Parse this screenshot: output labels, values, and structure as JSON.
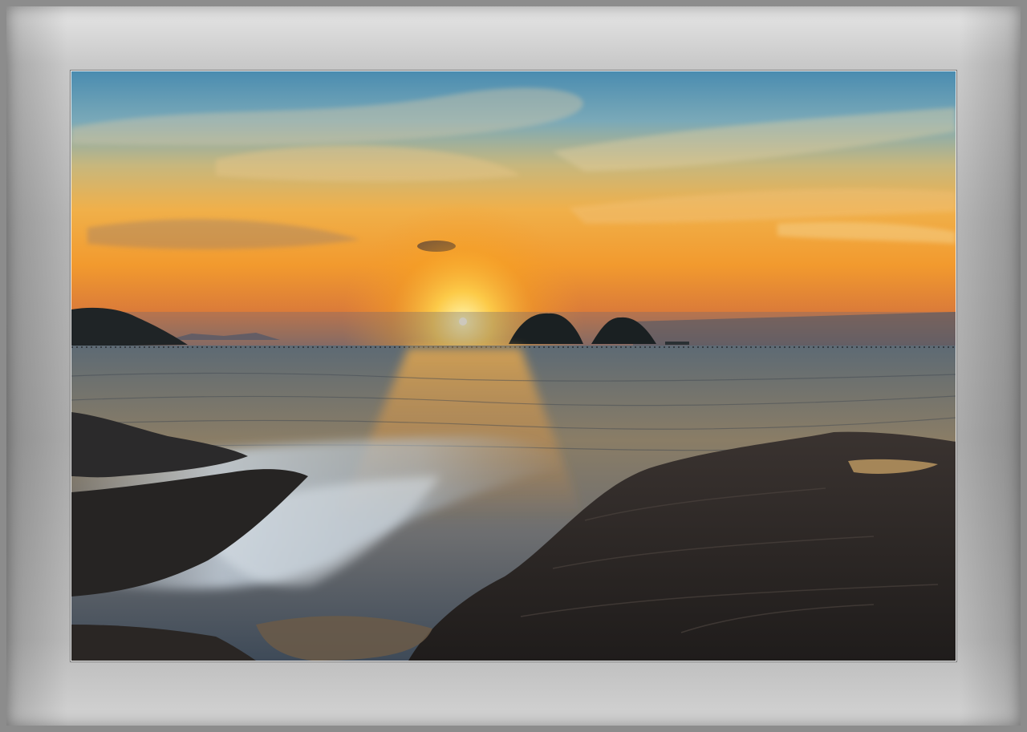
{
  "scene": {
    "subject": "sunset-seascape",
    "colors": {
      "frame_outer": "#8c8c8c",
      "mat": "#b4b4b4",
      "sky_top": "#4f8fb0",
      "sky_horizon": "#f29a2e",
      "sun": "#fff6c8",
      "sea": "#6f6a5c",
      "rocks": "#2a2624"
    }
  }
}
